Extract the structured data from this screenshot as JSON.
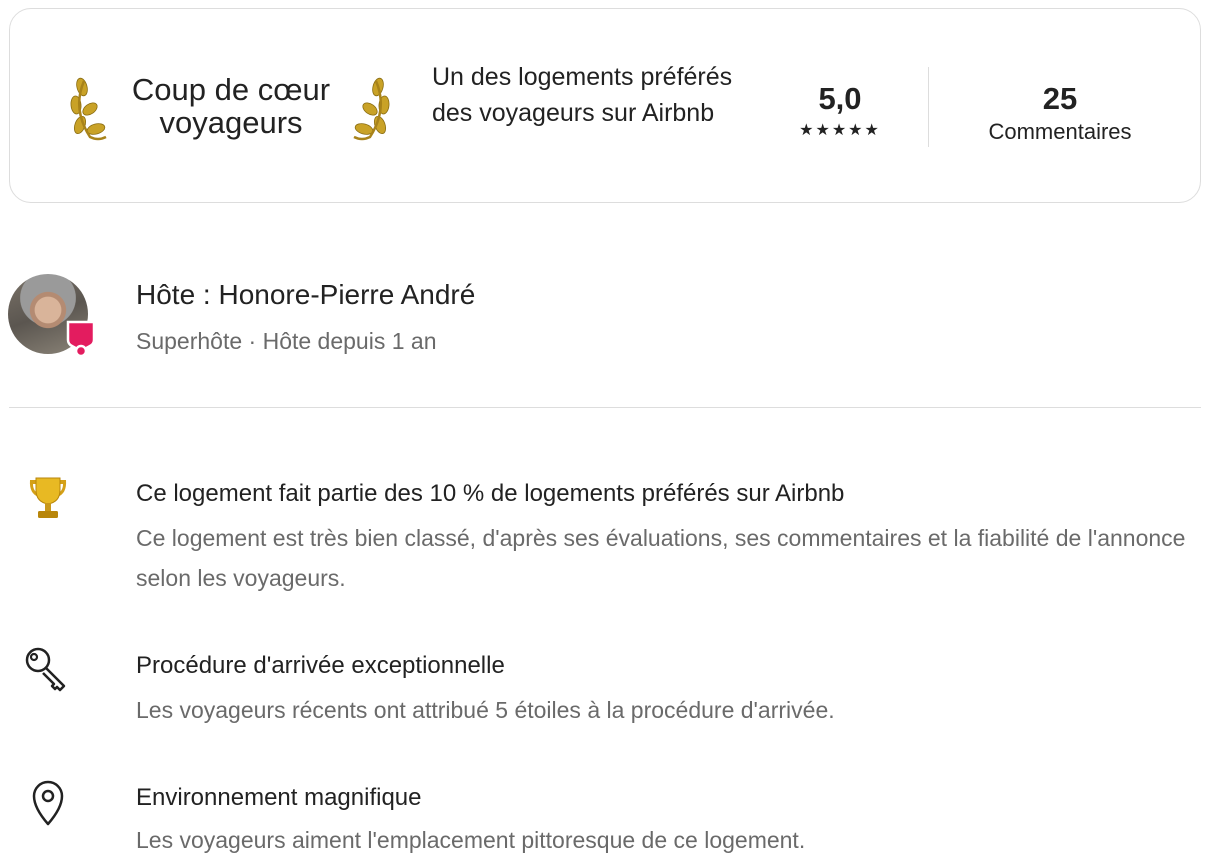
{
  "guest_favorite": {
    "title_line1": "Coup de cœur",
    "title_line2": "voyageurs",
    "description": "Un des logements préférés des voyageurs sur Airbnb",
    "rating": "5,0",
    "stars": "★★★★★",
    "reviews_count": "25",
    "reviews_label": "Commentaires",
    "laurel_color": "#c9a227"
  },
  "host": {
    "name": "Hôte : Honore-Pierre André",
    "subtitle": "Superhôte · Hôte depuis 1 an",
    "badge_color": "#e31c5f"
  },
  "highlights": [
    {
      "icon": "trophy-icon",
      "title": "Ce logement fait partie des 10 % de logements préférés sur Airbnb",
      "text": "Ce logement est très bien classé, d'après ses évaluations, ses commentaires et la fiabilité de l'annonce selon les voyageurs."
    },
    {
      "icon": "key-icon",
      "title": "Procédure d'arrivée exceptionnelle",
      "text": "Les voyageurs récents ont attribué 5 étoiles à la procédure d'arrivée."
    },
    {
      "icon": "location-pin-icon",
      "title": "Environnement magnifique",
      "text": "Les voyageurs aiment l'emplacement pittoresque de ce logement."
    }
  ]
}
